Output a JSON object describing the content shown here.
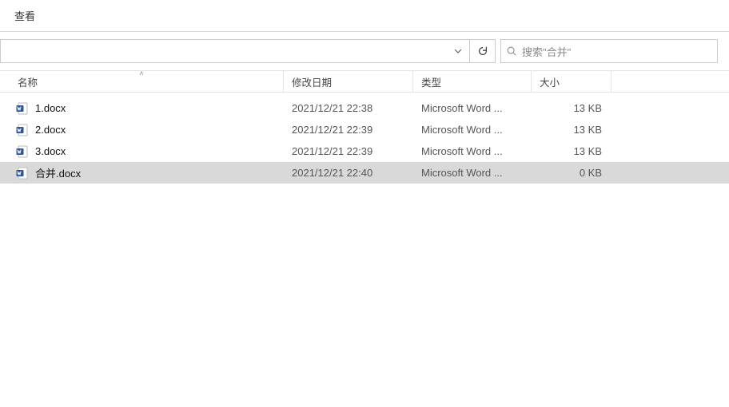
{
  "menu": {
    "view_label": "查看"
  },
  "address": {
    "text": "‍"
  },
  "search": {
    "placeholder": "搜索\"合并\""
  },
  "columns": {
    "name": "名称",
    "date": "修改日期",
    "type": "类型",
    "size": "大小",
    "sort_indicator": "˄"
  },
  "rows": [
    {
      "name": "1.docx",
      "date": "2021/12/21 22:38",
      "type": "Microsoft Word ...",
      "size": "13 KB",
      "selected": false
    },
    {
      "name": "2.docx",
      "date": "2021/12/21 22:39",
      "type": "Microsoft Word ...",
      "size": "13 KB",
      "selected": false
    },
    {
      "name": "3.docx",
      "date": "2021/12/21 22:39",
      "type": "Microsoft Word ...",
      "size": "13 KB",
      "selected": false
    },
    {
      "name": "合并.docx",
      "date": "2021/12/21 22:40",
      "type": "Microsoft Word ...",
      "size": "0 KB",
      "selected": true
    }
  ]
}
